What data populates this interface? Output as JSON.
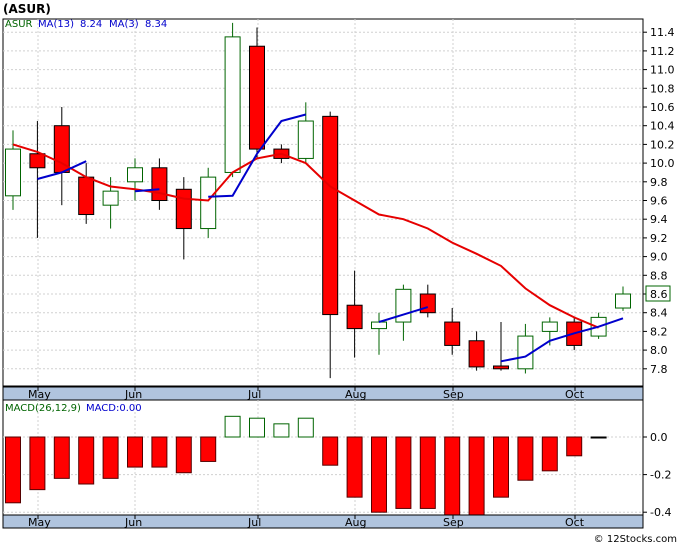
{
  "header": {
    "title": "(ASUR)"
  },
  "legend": {
    "symbol": "ASUR",
    "ma13_label": "MA(13)",
    "ma13_value": "8.24",
    "ma3_label": "MA(3)",
    "ma3_value": "8.34",
    "macd_label": "MACD(26,12,9)",
    "macd_value_label": "MACD:0.00"
  },
  "footer": {
    "source": "© 12Stocks.com"
  },
  "colors": {
    "up": "#006400",
    "down": "#ff0000",
    "ma13": "#e60000",
    "ma3": "#0000cc",
    "last_price": "#006400"
  },
  "chart_data": [
    {
      "type": "candlestick",
      "title": "(ASUR)",
      "y_axis": {
        "ticks": [
          7.8,
          8.0,
          8.2,
          8.4,
          8.6,
          8.8,
          9.0,
          9.2,
          9.4,
          9.6,
          9.8,
          10.0,
          10.2,
          10.4,
          10.6,
          10.8,
          11.0,
          11.2,
          11.4
        ],
        "ylim": [
          7.7,
          11.6
        ],
        "side": "right"
      },
      "x_axis": {
        "month_labels": [
          "May",
          "Jun",
          "Jul",
          "Aug",
          "Sep",
          "Oct"
        ]
      },
      "last_price_label": "8.6",
      "grid": true,
      "candles": [
        {
          "open": 9.65,
          "high": 10.35,
          "low": 9.5,
          "close": 10.15
        },
        {
          "open": 10.1,
          "high": 10.45,
          "low": 9.2,
          "close": 9.95
        },
        {
          "open": 10.4,
          "high": 10.6,
          "low": 9.55,
          "close": 9.9
        },
        {
          "open": 9.85,
          "high": 10.0,
          "low": 9.35,
          "close": 9.45
        },
        {
          "open": 9.55,
          "high": 9.85,
          "low": 9.3,
          "close": 9.7
        },
        {
          "open": 9.8,
          "high": 10.05,
          "low": 9.6,
          "close": 9.95
        },
        {
          "open": 9.95,
          "high": 10.05,
          "low": 9.5,
          "close": 9.6
        },
        {
          "open": 9.72,
          "high": 9.85,
          "low": 8.97,
          "close": 9.3
        },
        {
          "open": 9.3,
          "high": 9.95,
          "low": 9.2,
          "close": 9.85
        },
        {
          "open": 9.9,
          "high": 11.5,
          "low": 9.85,
          "close": 11.35
        },
        {
          "open": 11.25,
          "high": 11.45,
          "low": 10.05,
          "close": 10.15
        },
        {
          "open": 10.15,
          "high": 10.2,
          "low": 10.0,
          "close": 10.05
        },
        {
          "open": 10.05,
          "high": 10.65,
          "low": 10.0,
          "close": 10.45
        },
        {
          "open": 10.5,
          "high": 10.55,
          "low": 7.7,
          "close": 8.38
        },
        {
          "open": 8.48,
          "high": 8.85,
          "low": 7.92,
          "close": 8.23
        },
        {
          "open": 8.23,
          "high": 8.4,
          "low": 7.95,
          "close": 8.3
        },
        {
          "open": 8.3,
          "high": 8.7,
          "low": 8.1,
          "close": 8.65
        },
        {
          "open": 8.6,
          "high": 8.7,
          "low": 8.35,
          "close": 8.4
        },
        {
          "open": 8.3,
          "high": 8.45,
          "low": 7.95,
          "close": 8.05
        },
        {
          "open": 8.1,
          "high": 8.2,
          "low": 7.78,
          "close": 7.82
        },
        {
          "open": 7.83,
          "high": 8.3,
          "low": 7.78,
          "close": 7.8
        },
        {
          "open": 7.8,
          "high": 8.28,
          "low": 7.75,
          "close": 8.15
        },
        {
          "open": 8.2,
          "high": 8.35,
          "low": 8.05,
          "close": 8.3
        },
        {
          "open": 8.3,
          "high": 8.35,
          "low": 8.0,
          "close": 8.05
        },
        {
          "open": 8.15,
          "high": 8.4,
          "low": 8.12,
          "close": 8.35
        },
        {
          "open": 8.45,
          "high": 8.68,
          "low": 8.42,
          "close": 8.6
        }
      ],
      "series": [
        {
          "name": "MA(13)",
          "color": "#e60000",
          "values": [
            10.2,
            10.12,
            10.0,
            9.85,
            9.75,
            9.72,
            9.68,
            9.62,
            9.6,
            9.9,
            10.05,
            10.1,
            10.0,
            9.75,
            9.6,
            9.45,
            9.4,
            9.3,
            9.15,
            9.03,
            8.9,
            8.66,
            8.48,
            8.35,
            8.24
          ]
        },
        {
          "name": "MA(3)",
          "color": "#0000cc",
          "values": [
            null,
            9.83,
            9.9,
            10.02,
            null,
            9.7,
            9.72,
            null,
            9.64,
            9.65,
            10.1,
            10.45,
            10.52,
            null,
            null,
            8.3,
            8.38,
            8.46,
            null,
            null,
            7.88,
            7.93,
            8.1,
            8.18,
            8.25,
            8.34
          ]
        }
      ]
    },
    {
      "type": "bar",
      "title": "MACD(26,12,9)",
      "y_axis": {
        "ticks": [
          0.0,
          -0.2,
          -0.4
        ],
        "ylim": [
          -0.43,
          0.15
        ],
        "side": "right"
      },
      "x_axis": {
        "month_labels": [
          "May",
          "Jun",
          "Jul",
          "Aug",
          "Sep",
          "Oct"
        ]
      },
      "values": [
        -0.35,
        -0.28,
        -0.22,
        -0.25,
        -0.22,
        -0.16,
        -0.16,
        -0.19,
        -0.13,
        0.11,
        0.1,
        0.07,
        0.1,
        -0.15,
        -0.32,
        -0.4,
        -0.38,
        -0.38,
        -0.42,
        -0.43,
        -0.32,
        -0.23,
        -0.18,
        -0.1,
        0.0
      ]
    }
  ]
}
